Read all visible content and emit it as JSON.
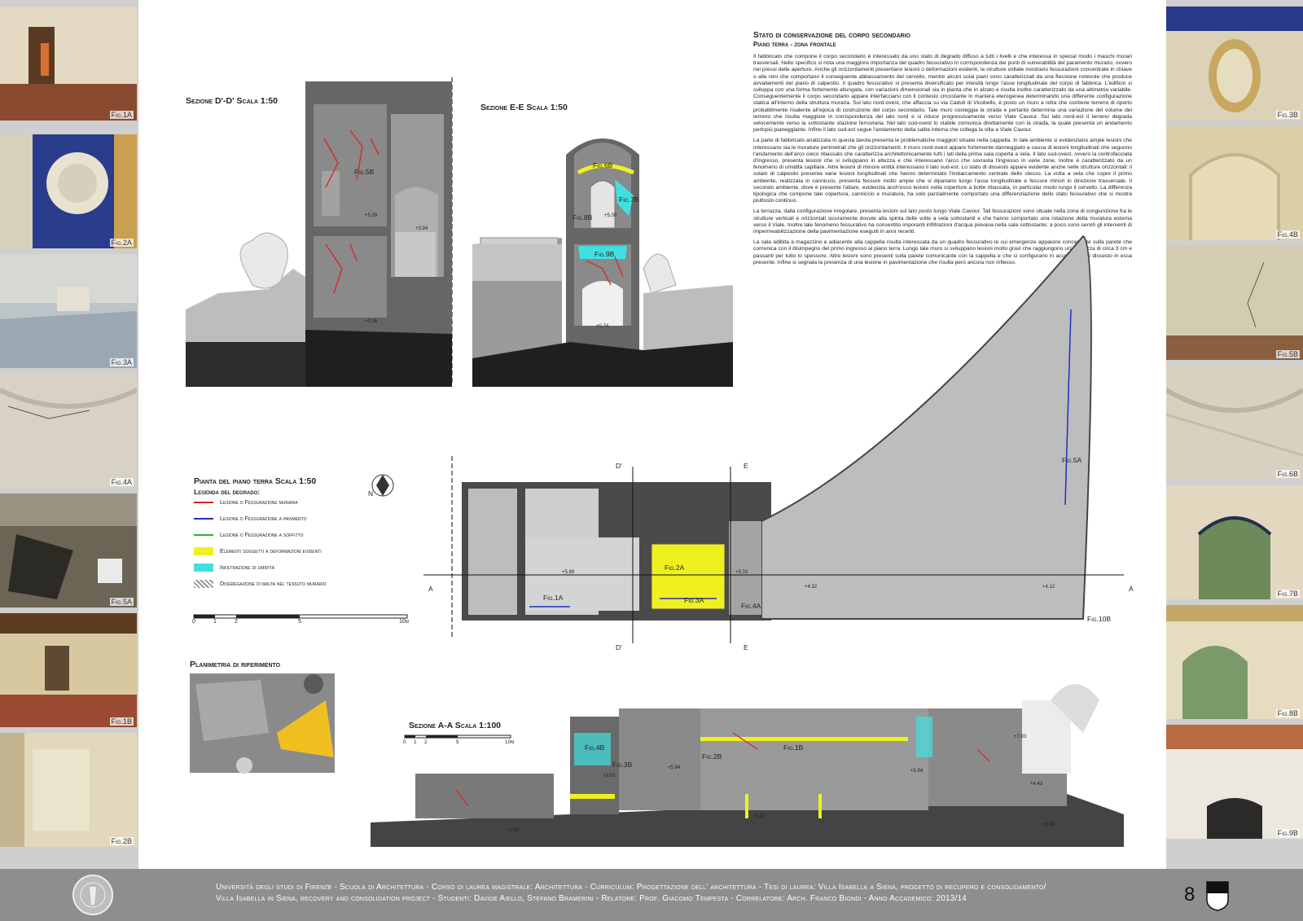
{
  "header": {
    "title": "Stato di conservazione del corpo secondario",
    "subtitle": "Piano terra - zona frontale"
  },
  "body_paragraphs": [
    "Il fabbricato che compone il corpo secondario è interessato da uno stato di degrado diffuso a tutti i livelli e che interessa in special modo i maschi murari trasversali. Nello specifico si nota una maggiore importanza del quadro fessurativo in corrispondenza dei punti di vulnerabilità del paramento murario, ovvero nei pressi delle aperture. Anche gli orizzontamenti presentano lesioni o deformazioni evidenti, le strutture voltate mostrano fessurazioni concentrate in chiave o alle reni che comportano il conseguente abbassamento del cervello, mentre alcuni solai piani sono caratterizzati da una flessione notevole che produce avvallamenti del piano di calpestio. Il quadro fessurativo si presenta diversificato per intesità lungo l'asse longitudinale del corpo di fabbrica. L'edificio si sviluppa con una forma fortemente allungata, con variazioni dimensionali sia in pianta che in alzato e risulta inoltre caratterizzato da una altimetria variabile. Conseguentemente il corpo secondario appare interfacciarsi con il contesto circostante in maniera eterogenea determinando una differente configurazione statica all'interno della struttura muraria. Sul lato nord-ovest, che affaccia su via Caduti di Vicobello, è posto un muro a retta che contiene terreno di riporto probabilmente risalente all'epoca di costruzione del corpo secondario. Tale muro costeggia la strada e pertanto determina una variazione del volume del terreno che risulta maggiore in corrispondenza del lato nord e si riduce progressivamente verso Viale Cavour. Sul lato nord-est il terreno degrada velocemente verso la sottostante stazione ferroviaria. Nel lato sud-ovest lo stabile comunica direttamente con la strada, la quale presenta un andamento perlopiù pianeggiante. Infine il lato sud-est segue l'andamento della salita interna che collega la villa a Viale Cavour.",
    "La parte di fabbricato analizzata in questa tavola presenta le problematiche maggiori situate nella cappella. In tale ambiente si evidenziano ampie lesioni che interessano sia le murature perimetrali che gli orizzontamenti. Il muro nord-ovest appare fortemente danneggiato a causa di lesioni longitudinali che seguono l'andamento dell'arco cieco ribassato che caratterizza architettonicamente tutti i lati della prima sala coperta a vela. Il lato sud-ovest, ovvero la controfacciata d'ingresso, presenta lesioni che si sviluppano in altezza e che interessano l'arco che sovrasta l'ingresso in varie zone, inoltre è caratterizzato da un fenomeno di umidità capillare. Altre lesioni di minore entità interessano il lato sud-est. Lo stato di dissesto appare evidente anche nelle strutture orizzontali: il solaio di calpesito presenta varie lesioni longitudinali che hanno determinato l'imbarcamento centrale dello stesso. La volta a vela che copre il primo ambiente, realizzata in canniccio, presenta fessure molto ampie che si dipanano lungo l'asse longitudinale e fessure minori in direzione trasversale. Il secondo ambiente, dove è presente l'altare, evidenzia anch'esso lesioni nella coperture a botte ribassata, in particolar modo lungo il cervello. La differenza tipologica che compone tale copertura, canniccio e muratura, ha solo parzialmente comportato una differenziazione dello stato fessurativo che si mostra piuttosto continuo.",
    "La terrazza, dalla configurazione irregolare, presenta lesioni sul lato posto lungo Viale Cavour. Tali fessurazioni sono situate nella zona di congiunzione fra le strutture verticali e orizzontali sicuramente dovute alla spinta delle volte a vela sottostanti e che hanno comportato una rotazione della muratura esterna verso il Viale. Inoltre tale fenomeno fessurativo ha consentito imporanti infiltrazioni d'acqua piovana nella sala sottostante; a poco sono serviti gli interventi di impermeabilizzazione della pavimentazione eseguiti in anni recenti.",
    "La sala adibita a magazzino e adiacente alla cappella risulta interessata da un quadro fessurativo le cui emergenze appaiono concentrate sulla parete che comunica con il disimpegno del primo ingresso al piano terra. Lungo tale muro si sviluppano lesioni molto gravi che raggiungono un'ampiezza di circa 3 cm e passanti per tutto lo spessore. Altre lesioni sono presenti sulla parete comunicante con la cappella e che si configurano in accordo con il dissesto in essa presente. Infine si segnala la presenza di una lesione in pavimentazione che risulta però ancora non inflesso."
  ],
  "drawings": {
    "section_dd": "Sezione D'-D'   Scala 1:50",
    "section_ee": "Sezione E-E   Scala 1:50",
    "plan": "Pianta del piano terra   Scala 1:50",
    "legend_title": "Legenda del degrado:",
    "site_plan": "Planimetria di riferimento",
    "section_aa": "Sezione A-A   Scala 1:100"
  },
  "legend": [
    {
      "label": "Lesione o Fessurazione muraria",
      "color": "#e02020",
      "kind": "line"
    },
    {
      "label": "Lesione o Fessurazione a pavimento",
      "color": "#2030c0",
      "kind": "line"
    },
    {
      "label": "Lesione o Fessurazione a soffitto",
      "color": "#30b030",
      "kind": "line"
    },
    {
      "label": "Elementi soggetti a deformazioni evidenti",
      "color": "#f0f020",
      "kind": "fill"
    },
    {
      "label": "Infiltrazione di umidità",
      "color": "#40e0e0",
      "kind": "fill"
    },
    {
      "label": "Disgregazione di malta nel tessuto murario",
      "color": "#999999",
      "kind": "hatch"
    }
  ],
  "scale_bar_plan": [
    "0",
    "1",
    "2",
    "5",
    "10m"
  ],
  "scale_bar_aa": [
    "0",
    "1",
    "2",
    "5",
    "10m"
  ],
  "compass": "N",
  "plan_labels": {
    "cut_a_left": "A",
    "cut_a_right": "A",
    "cut_d_top": "D'",
    "cut_d_bottom": "D'",
    "cut_e_top": "E",
    "cut_e_bottom": "E",
    "fig_1a": "Fig.1A",
    "fig_2a": "Fig.2A",
    "fig_3a": "Fig.3A",
    "fig_4a": "Fig.4A",
    "fig_5a": "Fig.5A",
    "fig_10b": "Fig.10B",
    "lv1": "+5.88",
    "lv2": "+5.03",
    "lv3": "+4.32",
    "lv4": "+4.12"
  },
  "section_labels": {
    "fig_5b": "Fig.5B",
    "fig_6b": "Fig.6B",
    "fig_7b": "Fig.7B",
    "fig_8b": "Fig.8B",
    "fig_9b": "Fig.9B",
    "fig_4b": "Fig.4B",
    "fig_3b": "Fig.3B",
    "fig_2b": "Fig.2B",
    "fig_1b": "Fig.1B",
    "lv_dd1": "+5.39",
    "lv_dd2": "+3.94",
    "lv_dd3": "+0.36",
    "lv_ee1": "+5.39",
    "lv_ee2": "+0.74",
    "lv_aa1": "+7.83",
    "lv_aa2": "+5.94",
    "lv_aa3": "+4.43",
    "lv_aa4": "+0.80",
    "lv_aa5": "+0.06",
    "lv_aa6": "+3.03",
    "lv_aa7": "+5.94",
    "lv_aa8": "+3.87"
  },
  "photos_left": [
    "Fig.1A",
    "Fig.2A",
    "Fig.3A",
    "Fig.4A",
    "Fig.5A",
    "Fig.1B",
    "Fig.2B"
  ],
  "photos_right": [
    "Fig.3B",
    "Fig.4B",
    "Fig.5B",
    "Fig.6B",
    "Fig.7B",
    "Fig.8B",
    "Fig.9B"
  ],
  "footer": {
    "line1": "Università degli studi di Firenze - Scuola di Architettura - Corso di laurea magistrale: Architettura - Curriculum: Progettazione dell' architettura - Tesi di laurea: Villa Isabella a Siena, progetto di recupero e consolidamento/",
    "line2": "Villa Isabella in Siena, recovery and consolidation project - Studenti: Davide Aiello, Stefano Bramerini - Relatore: Prof. Giacomo Tempesta - Correlatore: Arch. Franco Biondi - Anno Accademico: 2013/14",
    "page_number": "8"
  }
}
